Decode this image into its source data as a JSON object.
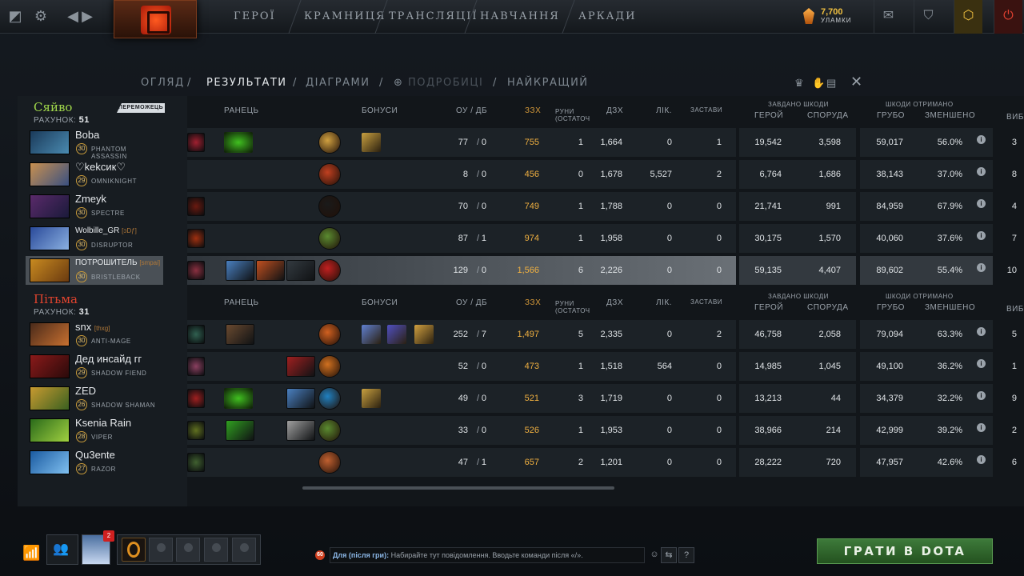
{
  "topbar": {
    "nav": [
      "ГЕРОЇ",
      "КРАМНИЦЯ",
      "ТРАНСЛЯЦІЇ",
      "НАВЧАННЯ",
      "АРКАДИ"
    ],
    "shards_value": "7,700",
    "shards_label": "УЛАМКИ"
  },
  "subnav": {
    "overview": "ОГЛЯД",
    "results": "РЕЗУЛЬТАТИ",
    "graphs": "ДІАГРАМИ",
    "details": "ПОДРОБИЦІ",
    "best": "НАЙКРАЩИЙ",
    "sep": "/"
  },
  "headers": {
    "backpack": "РАНЕЦЬ",
    "buffs": "БОНУСИ",
    "xp_ab": "ОУ / ДБ",
    "xpm": "ЗЗХ",
    "runes": "РУНИ (ОСТАТОЧ...",
    "runes_a": "РУНИ",
    "runes_b": "(ОСТАТОЧ",
    "gpm": "ДЗХ",
    "heal": "ЛІК.",
    "wards": "ЗАСТАВИ",
    "dmg_dealt": "ЗАВДАНО ШКОДИ",
    "heroes": "ГЕРОЙ",
    "buildings": "СПОРУДА",
    "dmg_recv": "ШКОДИ ОТРИМАНО",
    "raw": "ГРУБО",
    "reduced": "ЗМЕНШЕНО",
    "kill": "ВИБ"
  },
  "radiant": {
    "name": "Сяйво",
    "score_label": "РАХУНОК:",
    "score": "51",
    "winner": "ПЕРЕМОЖЕЦЬ",
    "players": [
      {
        "name": "Boba",
        "tag": "",
        "level": "30",
        "hero": "PHANTOM ASSASSIN",
        "xp": "77",
        "db": "0",
        "xpm": "755",
        "runes": "1",
        "gpm": "1,664",
        "heal": "0",
        "wards": "1",
        "hero_dmg": "19,542",
        "bld_dmg": "3,598",
        "raw": "59,017",
        "reduced": "56.0%",
        "kills": "3",
        "sel": false
      },
      {
        "name": "♡kekcик♡",
        "tag": "",
        "level": "29",
        "hero": "OMNIKNIGHT",
        "xp": "8",
        "db": "0",
        "xpm": "456",
        "runes": "0",
        "gpm": "1,678",
        "heal": "5,527",
        "wards": "2",
        "hero_dmg": "6,764",
        "bld_dmg": "1,686",
        "raw": "38,143",
        "reduced": "37.0%",
        "kills": "8",
        "sel": false
      },
      {
        "name": "Zmeyk",
        "tag": "",
        "level": "30",
        "hero": "SPECTRE",
        "xp": "70",
        "db": "0",
        "xpm": "749",
        "runes": "1",
        "gpm": "1,788",
        "heal": "0",
        "wards": "0",
        "hero_dmg": "21,741",
        "bld_dmg": "991",
        "raw": "84,959",
        "reduced": "67.9%",
        "kills": "4",
        "sel": false
      },
      {
        "name": "Wolbille_GR",
        "tag": "[ↄDƒ]",
        "level": "30",
        "hero": "DISRUPTOR",
        "xp": "87",
        "db": "1",
        "xpm": "974",
        "runes": "1",
        "gpm": "1,958",
        "heal": "0",
        "wards": "0",
        "hero_dmg": "30,175",
        "bld_dmg": "1,570",
        "raw": "40,060",
        "reduced": "37.6%",
        "kills": "7",
        "sel": false
      },
      {
        "name": "ПОТРОШИТЕЛЬ",
        "tag": "[smpai]",
        "level": "30",
        "hero": "BRISTLEBACK",
        "xp": "129",
        "db": "0",
        "xpm": "1,566",
        "runes": "6",
        "gpm": "2,226",
        "heal": "0",
        "wards": "0",
        "hero_dmg": "59,135",
        "bld_dmg": "4,407",
        "raw": "89,602",
        "reduced": "55.4%",
        "kills": "10",
        "sel": true
      }
    ]
  },
  "dire": {
    "name": "Пітьма",
    "score_label": "РАХУНОК:",
    "score": "31",
    "players": [
      {
        "name": "snx",
        "tag": "[thxg]",
        "level": "30",
        "hero": "ANTI-MAGE",
        "xp": "252",
        "db": "7",
        "xpm": "1,497",
        "runes": "5",
        "gpm": "2,335",
        "heal": "0",
        "wards": "2",
        "hero_dmg": "46,758",
        "bld_dmg": "2,058",
        "raw": "79,094",
        "reduced": "63.3%",
        "kills": "5",
        "sel": false
      },
      {
        "name": "Дед инсайд гг",
        "tag": "",
        "level": "29",
        "hero": "SHADOW FIEND",
        "xp": "52",
        "db": "0",
        "xpm": "473",
        "runes": "1",
        "gpm": "1,518",
        "heal": "564",
        "wards": "0",
        "hero_dmg": "14,985",
        "bld_dmg": "1,045",
        "raw": "49,100",
        "reduced": "36.2%",
        "kills": "1",
        "sel": false
      },
      {
        "name": "ZED",
        "tag": "",
        "level": "26",
        "hero": "SHADOW SHAMAN",
        "xp": "49",
        "db": "0",
        "xpm": "521",
        "runes": "3",
        "gpm": "1,719",
        "heal": "0",
        "wards": "0",
        "hero_dmg": "13,213",
        "bld_dmg": "44",
        "raw": "34,379",
        "reduced": "32.2%",
        "kills": "9",
        "sel": false
      },
      {
        "name": "Ksenia Rain",
        "tag": "",
        "level": "28",
        "hero": "VIPER",
        "xp": "33",
        "db": "0",
        "xpm": "526",
        "runes": "1",
        "gpm": "1,953",
        "heal": "0",
        "wards": "0",
        "hero_dmg": "38,966",
        "bld_dmg": "214",
        "raw": "42,999",
        "reduced": "39.2%",
        "kills": "2",
        "sel": false
      },
      {
        "name": "Qu3ente",
        "tag": "",
        "level": "27",
        "hero": "RAZOR",
        "xp": "47",
        "db": "1",
        "xpm": "657",
        "runes": "2",
        "gpm": "1,201",
        "heal": "0",
        "wards": "0",
        "hero_dmg": "28,222",
        "bld_dmg": "720",
        "raw": "47,957",
        "reduced": "42.6%",
        "kills": "6",
        "sel": false
      }
    ]
  },
  "bottom": {
    "friends_badge": "2",
    "chat_count": "60",
    "chat_channel": "Для (після гри):",
    "chat_placeholder": "Набирайте тут повідомлення. Вводьте команди після «/».",
    "play": "ГРАТИ В DOTA",
    "help": "?"
  },
  "colors": {
    "radiant": "#9fd64a",
    "dire": "#e0432e",
    "gold": "#f0b040",
    "play": "#3d7a3a"
  }
}
